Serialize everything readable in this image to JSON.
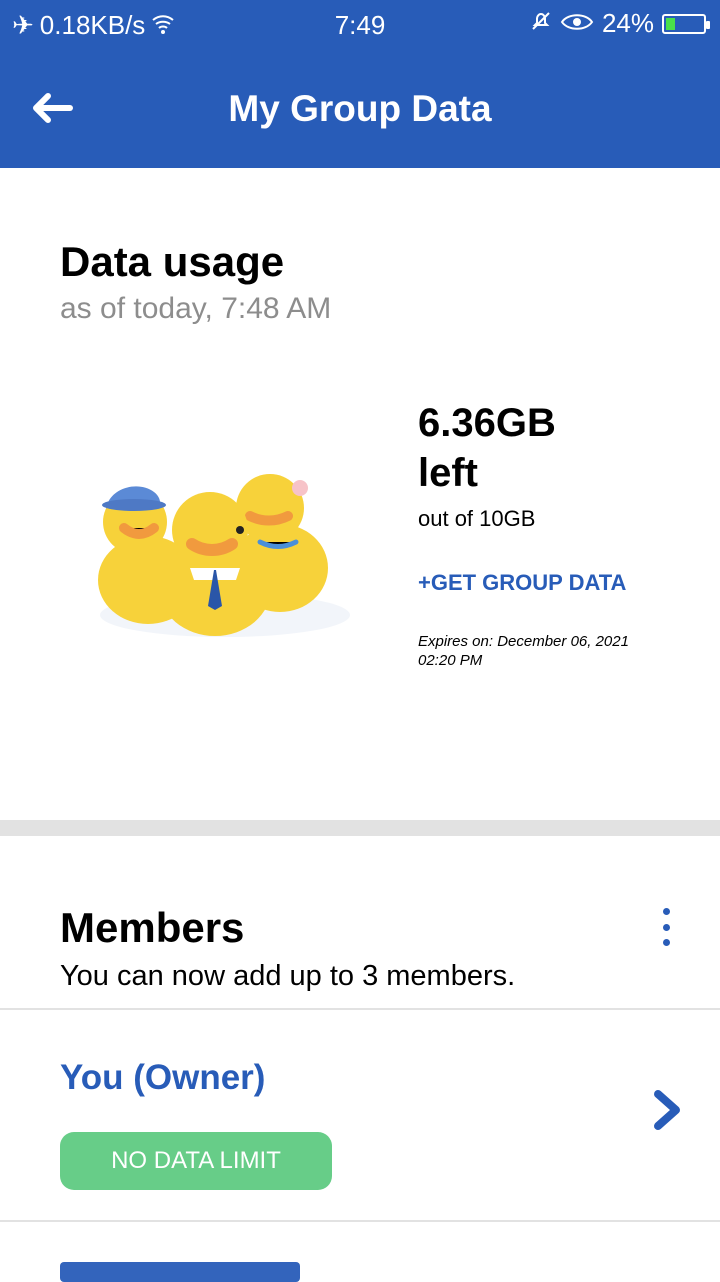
{
  "status": {
    "speed": "0.18KB/s",
    "time": "7:49",
    "battery": "24%",
    "battery_level": 0.24
  },
  "header": {
    "title": "My Group Data"
  },
  "usage": {
    "title": "Data usage",
    "as_of": "as of today, 7:48 AM",
    "left_amount": "6.36GB",
    "left_word": "left",
    "out_of": "out of 10GB",
    "get_data": "+GET GROUP DATA",
    "expires": "Expires on: December 06, 2021 02:20 PM"
  },
  "members": {
    "title": "Members",
    "desc": "You can now add up to 3 members.",
    "owner": "You (Owner)",
    "badge": "NO DATA LIMIT"
  },
  "colors": {
    "brand": "#285cb8",
    "badge": "#67cd88"
  }
}
